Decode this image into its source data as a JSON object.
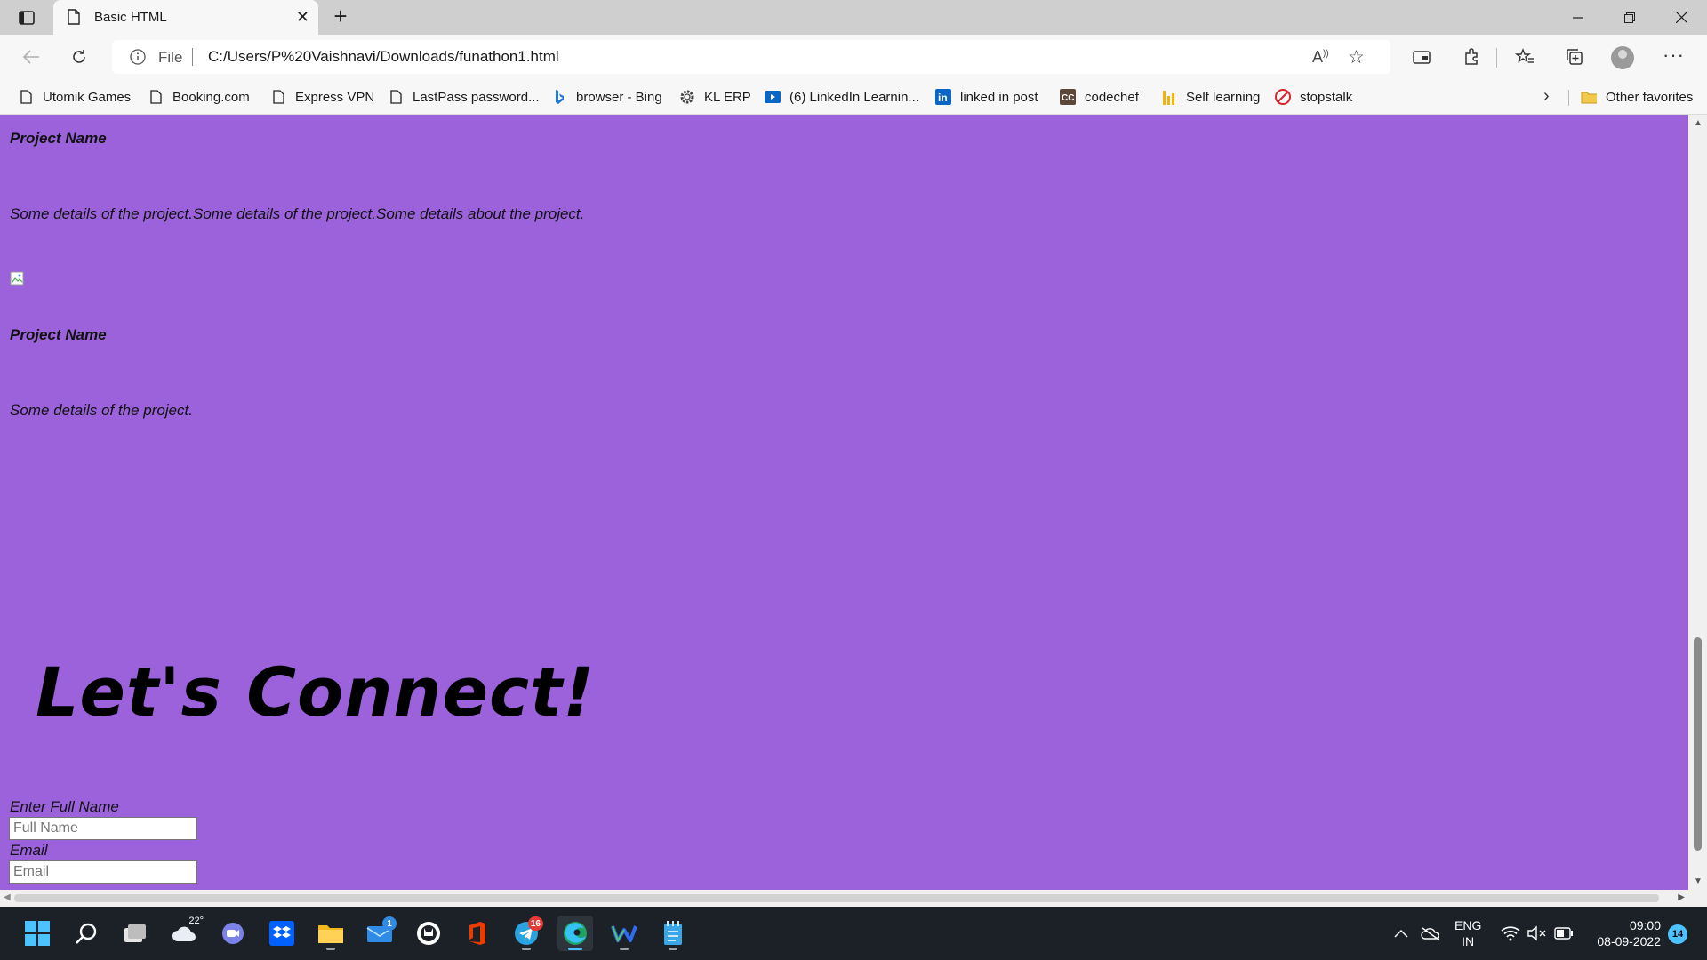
{
  "browser": {
    "tab_title": "Basic HTML",
    "file_label": "File",
    "url": "C:/Users/P%20Vaishnavi/Downloads/funathon1.html"
  },
  "bookmarks": [
    {
      "label": "Utomik Games",
      "icon": "page-icon"
    },
    {
      "label": "Booking.com",
      "icon": "page-icon"
    },
    {
      "label": "Express VPN",
      "icon": "page-icon"
    },
    {
      "label": "LastPass password...",
      "icon": "page-icon"
    },
    {
      "label": "browser - Bing",
      "icon": "bing-icon"
    },
    {
      "label": "KL ERP",
      "icon": "gear-icon"
    },
    {
      "label": "(6) LinkedIn Learnin...",
      "icon": "linkedin-learning-icon"
    },
    {
      "label": "linked in post",
      "icon": "linkedin-icon"
    },
    {
      "label": "codechef",
      "icon": "codechef-icon"
    },
    {
      "label": "Self learning",
      "icon": "bars-icon"
    },
    {
      "label": "stopstalk",
      "icon": "stopstalk-icon"
    }
  ],
  "other_favorites": "Other favorites",
  "page": {
    "project1_name": "Project Name",
    "project1_details": "Some details of the project.Some details of the project.Some details about the project.",
    "project2_name": "Project Name",
    "project2_details": "Some details of the project.",
    "connect_heading": "Let's Connect!",
    "form": {
      "name_label": "Enter Full Name",
      "name_placeholder": "Full Name",
      "email_label": "Email",
      "email_placeholder": "Email"
    },
    "background_color": "#9b62dc"
  },
  "taskbar": {
    "weather_temp": "22°",
    "mail_badge": "1",
    "telegram_badge": "16",
    "language_line1": "ENG",
    "language_line2": "IN",
    "time": "09:00",
    "date": "08-09-2022",
    "notification_count": "14"
  }
}
